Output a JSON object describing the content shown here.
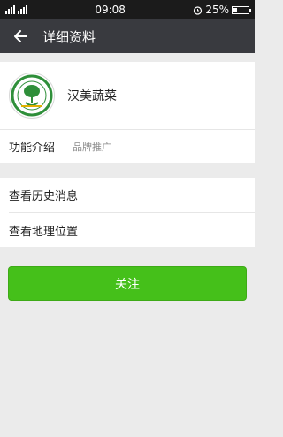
{
  "status_bar": {
    "time": "09:08",
    "battery_percent": "25%",
    "battery_level": 0.25,
    "icons": [
      "signal-icon",
      "signal-icon",
      "alarm-icon",
      "battery-icon"
    ]
  },
  "title_bar": {
    "back_icon": "arrow-left-icon",
    "title": "详细资料"
  },
  "profile": {
    "name": "汉美蔬菜",
    "avatar_icon": "tree-logo-icon"
  },
  "intro": {
    "label": "功能介绍",
    "value": "品牌推广"
  },
  "menu": {
    "items": [
      {
        "label": "查看历史消息"
      },
      {
        "label": "查看地理位置"
      }
    ]
  },
  "follow_button": {
    "label": "关注"
  },
  "colors": {
    "accent": "#45c01a",
    "title_bar": "#393a3f",
    "status_bar": "#1b1b1b",
    "background": "#ebebeb"
  }
}
